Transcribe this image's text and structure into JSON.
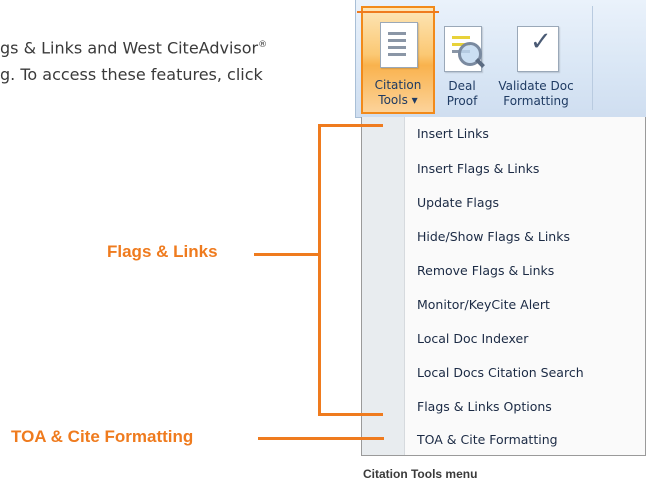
{
  "intro": {
    "line1": "gs & Links and West CiteAdvisor",
    "line1_sup": "®",
    "line2": "g. To access these features, click"
  },
  "ribbon": {
    "citation_tools": {
      "line1": "Citation",
      "line2": "Tools",
      "arrow": "▾",
      "icon": "document-icon"
    },
    "deal_proof": {
      "line1": "Deal",
      "line2": "Proof",
      "icon": "document-magnifier-icon"
    },
    "validate_doc": {
      "line1": "Validate Doc",
      "line2": "Formatting",
      "icon": "document-check-icon"
    }
  },
  "menu": {
    "items": [
      "Insert Links",
      "Insert Flags & Links",
      "Update Flags",
      "Hide/Show Flags & Links",
      "Remove Flags & Links",
      "Monitor/KeyCite Alert",
      "Local Doc Indexer",
      "Local Docs Citation Search",
      "Flags & Links Options",
      "TOA & Cite Formatting"
    ]
  },
  "callouts": {
    "flags_links": "Flags & Links",
    "toa": "TOA & Cite Formatting"
  },
  "caption": "Citation Tools menu",
  "colors": {
    "accent": "#ef7b1e",
    "menu_text": "#1b2a44",
    "ribbon_bg": "#d9e6f5"
  }
}
